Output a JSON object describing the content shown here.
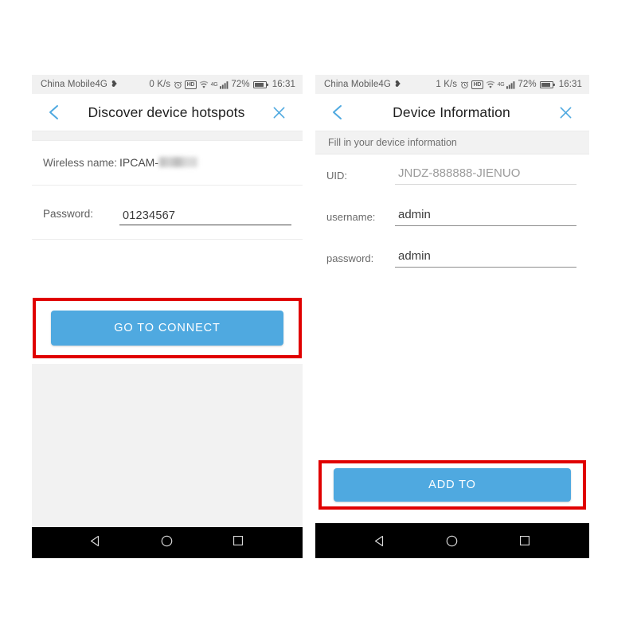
{
  "page": {
    "background": "#ffffff",
    "accent_blue": "#4fa9e0",
    "highlight_red": "#e00000"
  },
  "phones": [
    {
      "id": "left",
      "status_bar": {
        "carrier": "China Mobile4G",
        "heart_icon": "heart-icon",
        "data_rate": "0 K/s",
        "alarm_icon": "alarm-clock-icon",
        "hd_label": "HD",
        "wifi_icon": "wifi-icon",
        "network_type": "4G",
        "signal_icon": "signal-bars-icon",
        "battery_percent": "72%",
        "battery_icon": "battery-icon",
        "time": "16:31"
      },
      "title_bar": {
        "back_icon": "chevron-left-icon",
        "title": "Discover device hotspots",
        "close_icon": "close-x-icon"
      },
      "form": {
        "wireless_label": "Wireless name:",
        "wireless_value": "IPCAM-",
        "wireless_value_redacted": true,
        "password_label": "Password:",
        "password_value": "01234567"
      },
      "primary_button": {
        "label": "GO TO CONNECT",
        "highlighted": true
      },
      "nav_bar": {
        "back": "nav-back-triangle-icon",
        "home": "nav-home-circle-icon",
        "recents": "nav-recents-square-icon"
      }
    },
    {
      "id": "right",
      "status_bar": {
        "carrier": "China Mobile4G",
        "heart_icon": "heart-icon",
        "data_rate": "1 K/s",
        "alarm_icon": "alarm-clock-icon",
        "hd_label": "HD",
        "wifi_icon": "wifi-icon",
        "network_type": "4G",
        "signal_icon": "signal-bars-icon",
        "battery_percent": "72%",
        "battery_icon": "battery-icon",
        "time": "16:31"
      },
      "title_bar": {
        "back_icon": "chevron-left-icon",
        "title": "Device Information",
        "close_icon": "close-x-icon"
      },
      "section_hint": "Fill in your device information",
      "form": {
        "uid_label": "UID:",
        "uid_value": "JNDZ-888888-JIENUO",
        "username_label": "username:",
        "username_value": "admin",
        "password_label": "password:",
        "password_value": "admin"
      },
      "primary_button": {
        "label": "ADD TO",
        "highlighted": true
      },
      "nav_bar": {
        "back": "nav-back-triangle-icon",
        "home": "nav-home-circle-icon",
        "recents": "nav-recents-square-icon"
      }
    }
  ]
}
